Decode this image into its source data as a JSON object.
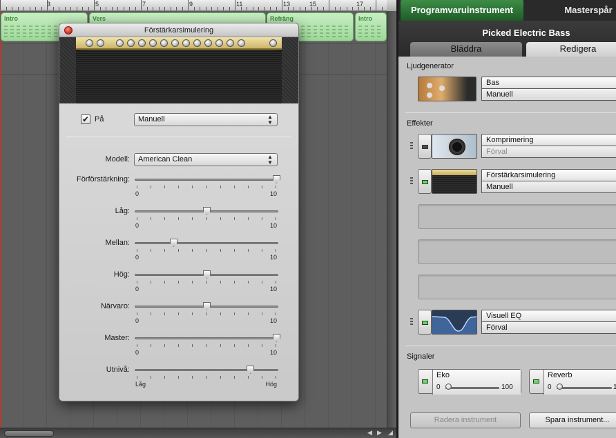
{
  "ruler": {
    "numbers": [
      "3",
      "5",
      "7",
      "9",
      "11",
      "13",
      "15",
      "17"
    ]
  },
  "regions": [
    {
      "name": "Intro"
    },
    {
      "name": "Vers"
    },
    {
      "name": "Refräng"
    },
    {
      "name": "Intro"
    }
  ],
  "amp_window": {
    "title": "Förstärkarsimulering",
    "enabled_label": "På",
    "enabled": true,
    "preset_value": "Manuell",
    "model_label": "Modell:",
    "model_value": "American Clean",
    "sliders": [
      {
        "label": "Förförstärkning:",
        "min": "0",
        "max": "10",
        "value": 10
      },
      {
        "label": "Låg:",
        "min": "0",
        "max": "10",
        "value": 5
      },
      {
        "label": "Mellan:",
        "min": "0",
        "max": "10",
        "value": 2.6
      },
      {
        "label": "Hög:",
        "min": "0",
        "max": "10",
        "value": 5
      },
      {
        "label": "Närvaro:",
        "min": "0",
        "max": "10",
        "value": 5
      },
      {
        "label": "Master:",
        "min": "0",
        "max": "10",
        "value": 10
      },
      {
        "label": "Utnivå:",
        "min": "Låg",
        "max": "Hög",
        "value": 8.1
      }
    ]
  },
  "right_panel": {
    "tab_software": "Programvaruinstrument",
    "tab_master": "Masterspår",
    "instrument_name": "Picked Electric Bass",
    "subtab_browse": "Bläddra",
    "subtab_edit": "Redigera",
    "generator_section": "Ljudgenerator",
    "generator": {
      "name": "Bas",
      "preset": "Manuell"
    },
    "effects_section": "Effekter",
    "effects": [
      {
        "name": "Komprimering",
        "preset": "Förval",
        "active": false
      },
      {
        "name": "Förstärkarsimulering",
        "preset": "Manuell",
        "active": true
      }
    ],
    "eq": {
      "name": "Visuell EQ",
      "preset": "Förval",
      "active": true
    },
    "signals_section": "Signaler",
    "sends": [
      {
        "name": "Eko",
        "min": "0",
        "max": "100",
        "value": 0
      },
      {
        "name": "Reverb",
        "min": "0",
        "max": "1",
        "value": 0
      }
    ],
    "delete_button": "Radera instrument",
    "save_button": "Spara instrument..."
  }
}
